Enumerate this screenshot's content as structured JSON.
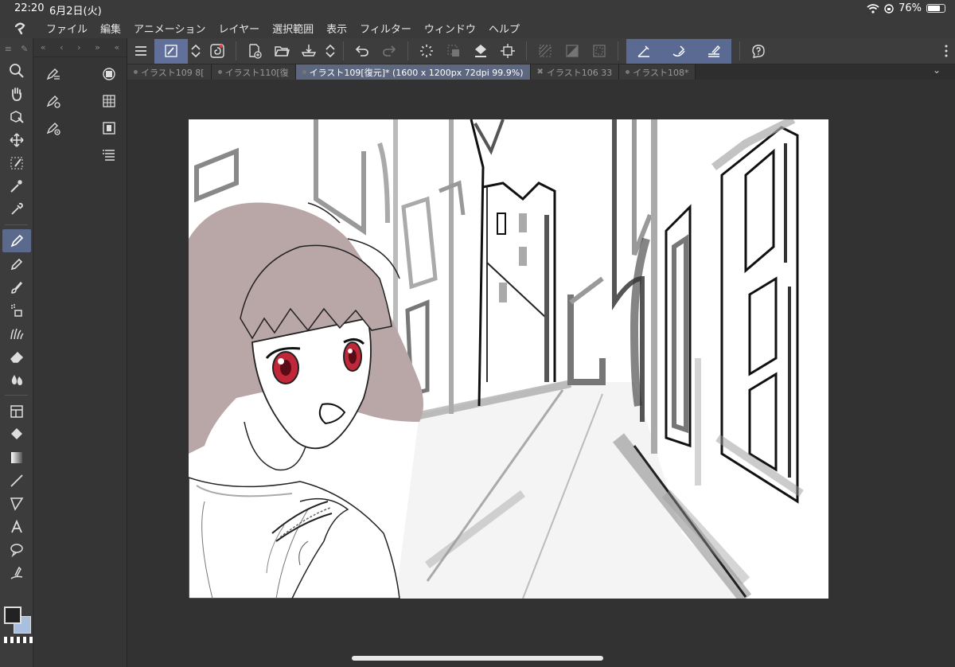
{
  "status": {
    "time": "22:20",
    "date": "6月2日(火)",
    "battery": "76%",
    "battery_level": 0.76
  },
  "menu": [
    "ファイル",
    "編集",
    "アニメーション",
    "レイヤー",
    "選択範囲",
    "表示",
    "フィルター",
    "ウィンドウ",
    "ヘルプ"
  ],
  "tabs": [
    {
      "label": "イラスト109 8[",
      "active": false
    },
    {
      "label": "イラスト110[復",
      "active": false
    },
    {
      "label": "イラスト109[復元]* (1600 x 1200px 72dpi 99.9%)",
      "active": true
    },
    {
      "label": "イラスト106 33",
      "active": false
    },
    {
      "label": "イラスト108*",
      "active": false
    }
  ],
  "colors": {
    "main": "#222222",
    "sub": "#a8bfe0",
    "accent": "#5d6780",
    "hair": "#b9a6a6",
    "eyes": "#c0283a"
  },
  "canvas_size": "1600 x 1200px",
  "zoom": "99.9%"
}
